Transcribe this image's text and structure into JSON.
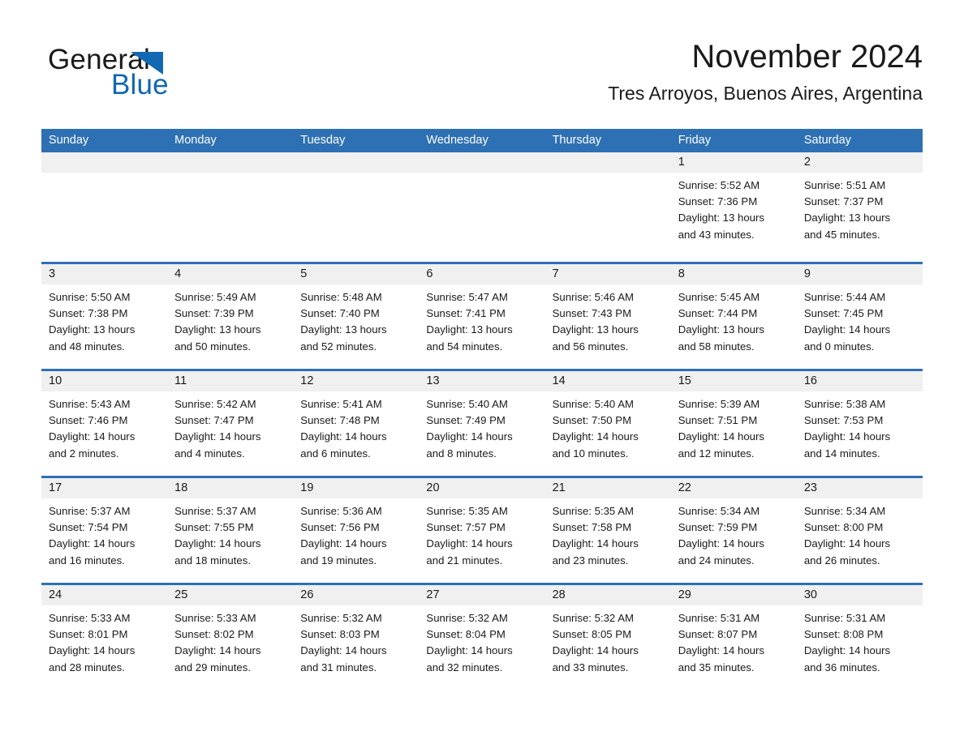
{
  "brand": {
    "name_part1": "General",
    "name_part2": "Blue",
    "triangle_color": "#1268b3",
    "text_color": "#1a1a1a"
  },
  "header": {
    "title": "November 2024",
    "location": "Tres Arroyos, Buenos Aires, Argentina"
  },
  "theme": {
    "header_blue": "#2e70b4",
    "date_strip_gray": "#f0f0f0",
    "cell_white": "#ffffff",
    "text_black": "#1a1a1a",
    "weekday_text": "#ffffff"
  },
  "calendar": {
    "weekdays": [
      "Sunday",
      "Monday",
      "Tuesday",
      "Wednesday",
      "Thursday",
      "Friday",
      "Saturday"
    ],
    "weeks": [
      [
        {
          "day": "",
          "empty": true,
          "lines": []
        },
        {
          "day": "",
          "empty": true,
          "lines": []
        },
        {
          "day": "",
          "empty": true,
          "lines": []
        },
        {
          "day": "",
          "empty": true,
          "lines": []
        },
        {
          "day": "",
          "empty": true,
          "lines": []
        },
        {
          "day": "1",
          "empty": false,
          "lines": [
            "Sunrise: 5:52 AM",
            "Sunset: 7:36 PM",
            "Daylight: 13 hours",
            "and 43 minutes."
          ]
        },
        {
          "day": "2",
          "empty": false,
          "lines": [
            "Sunrise: 5:51 AM",
            "Sunset: 7:37 PM",
            "Daylight: 13 hours",
            "and 45 minutes."
          ]
        }
      ],
      [
        {
          "day": "3",
          "empty": false,
          "lines": [
            "Sunrise: 5:50 AM",
            "Sunset: 7:38 PM",
            "Daylight: 13 hours",
            "and 48 minutes."
          ]
        },
        {
          "day": "4",
          "empty": false,
          "lines": [
            "Sunrise: 5:49 AM",
            "Sunset: 7:39 PM",
            "Daylight: 13 hours",
            "and 50 minutes."
          ]
        },
        {
          "day": "5",
          "empty": false,
          "lines": [
            "Sunrise: 5:48 AM",
            "Sunset: 7:40 PM",
            "Daylight: 13 hours",
            "and 52 minutes."
          ]
        },
        {
          "day": "6",
          "empty": false,
          "lines": [
            "Sunrise: 5:47 AM",
            "Sunset: 7:41 PM",
            "Daylight: 13 hours",
            "and 54 minutes."
          ]
        },
        {
          "day": "7",
          "empty": false,
          "lines": [
            "Sunrise: 5:46 AM",
            "Sunset: 7:43 PM",
            "Daylight: 13 hours",
            "and 56 minutes."
          ]
        },
        {
          "day": "8",
          "empty": false,
          "lines": [
            "Sunrise: 5:45 AM",
            "Sunset: 7:44 PM",
            "Daylight: 13 hours",
            "and 58 minutes."
          ]
        },
        {
          "day": "9",
          "empty": false,
          "lines": [
            "Sunrise: 5:44 AM",
            "Sunset: 7:45 PM",
            "Daylight: 14 hours",
            "and 0 minutes."
          ]
        }
      ],
      [
        {
          "day": "10",
          "empty": false,
          "lines": [
            "Sunrise: 5:43 AM",
            "Sunset: 7:46 PM",
            "Daylight: 14 hours",
            "and 2 minutes."
          ]
        },
        {
          "day": "11",
          "empty": false,
          "lines": [
            "Sunrise: 5:42 AM",
            "Sunset: 7:47 PM",
            "Daylight: 14 hours",
            "and 4 minutes."
          ]
        },
        {
          "day": "12",
          "empty": false,
          "lines": [
            "Sunrise: 5:41 AM",
            "Sunset: 7:48 PM",
            "Daylight: 14 hours",
            "and 6 minutes."
          ]
        },
        {
          "day": "13",
          "empty": false,
          "lines": [
            "Sunrise: 5:40 AM",
            "Sunset: 7:49 PM",
            "Daylight: 14 hours",
            "and 8 minutes."
          ]
        },
        {
          "day": "14",
          "empty": false,
          "lines": [
            "Sunrise: 5:40 AM",
            "Sunset: 7:50 PM",
            "Daylight: 14 hours",
            "and 10 minutes."
          ]
        },
        {
          "day": "15",
          "empty": false,
          "lines": [
            "Sunrise: 5:39 AM",
            "Sunset: 7:51 PM",
            "Daylight: 14 hours",
            "and 12 minutes."
          ]
        },
        {
          "day": "16",
          "empty": false,
          "lines": [
            "Sunrise: 5:38 AM",
            "Sunset: 7:53 PM",
            "Daylight: 14 hours",
            "and 14 minutes."
          ]
        }
      ],
      [
        {
          "day": "17",
          "empty": false,
          "lines": [
            "Sunrise: 5:37 AM",
            "Sunset: 7:54 PM",
            "Daylight: 14 hours",
            "and 16 minutes."
          ]
        },
        {
          "day": "18",
          "empty": false,
          "lines": [
            "Sunrise: 5:37 AM",
            "Sunset: 7:55 PM",
            "Daylight: 14 hours",
            "and 18 minutes."
          ]
        },
        {
          "day": "19",
          "empty": false,
          "lines": [
            "Sunrise: 5:36 AM",
            "Sunset: 7:56 PM",
            "Daylight: 14 hours",
            "and 19 minutes."
          ]
        },
        {
          "day": "20",
          "empty": false,
          "lines": [
            "Sunrise: 5:35 AM",
            "Sunset: 7:57 PM",
            "Daylight: 14 hours",
            "and 21 minutes."
          ]
        },
        {
          "day": "21",
          "empty": false,
          "lines": [
            "Sunrise: 5:35 AM",
            "Sunset: 7:58 PM",
            "Daylight: 14 hours",
            "and 23 minutes."
          ]
        },
        {
          "day": "22",
          "empty": false,
          "lines": [
            "Sunrise: 5:34 AM",
            "Sunset: 7:59 PM",
            "Daylight: 14 hours",
            "and 24 minutes."
          ]
        },
        {
          "day": "23",
          "empty": false,
          "lines": [
            "Sunrise: 5:34 AM",
            "Sunset: 8:00 PM",
            "Daylight: 14 hours",
            "and 26 minutes."
          ]
        }
      ],
      [
        {
          "day": "24",
          "empty": false,
          "lines": [
            "Sunrise: 5:33 AM",
            "Sunset: 8:01 PM",
            "Daylight: 14 hours",
            "and 28 minutes."
          ]
        },
        {
          "day": "25",
          "empty": false,
          "lines": [
            "Sunrise: 5:33 AM",
            "Sunset: 8:02 PM",
            "Daylight: 14 hours",
            "and 29 minutes."
          ]
        },
        {
          "day": "26",
          "empty": false,
          "lines": [
            "Sunrise: 5:32 AM",
            "Sunset: 8:03 PM",
            "Daylight: 14 hours",
            "and 31 minutes."
          ]
        },
        {
          "day": "27",
          "empty": false,
          "lines": [
            "Sunrise: 5:32 AM",
            "Sunset: 8:04 PM",
            "Daylight: 14 hours",
            "and 32 minutes."
          ]
        },
        {
          "day": "28",
          "empty": false,
          "lines": [
            "Sunrise: 5:32 AM",
            "Sunset: 8:05 PM",
            "Daylight: 14 hours",
            "and 33 minutes."
          ]
        },
        {
          "day": "29",
          "empty": false,
          "lines": [
            "Sunrise: 5:31 AM",
            "Sunset: 8:07 PM",
            "Daylight: 14 hours",
            "and 35 minutes."
          ]
        },
        {
          "day": "30",
          "empty": false,
          "lines": [
            "Sunrise: 5:31 AM",
            "Sunset: 8:08 PM",
            "Daylight: 14 hours",
            "and 36 minutes."
          ]
        }
      ]
    ]
  }
}
